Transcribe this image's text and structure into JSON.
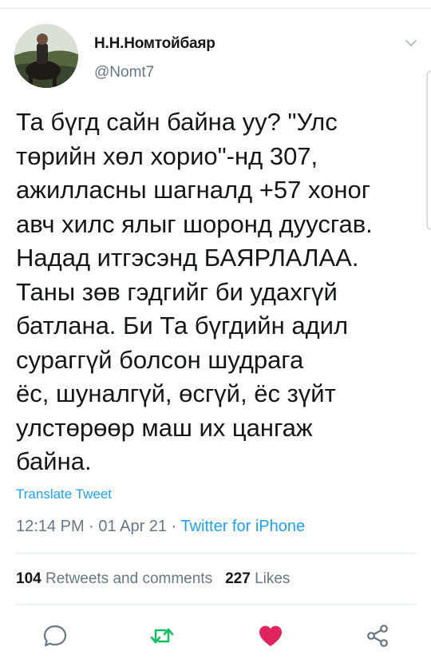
{
  "tweet": {
    "author_name": "Н.Н.Номтойбаяр",
    "author_handle": "@Nomt7",
    "text_lines": [
      "Та бүгд сайн байна уу? \"Улс",
      "төрийн хөл хорио\"-нд 307,",
      "ажилласны шагналд +57 хоног",
      "авч хилс ялыг шоронд дуусгав.",
      "Надад итгэсэнд БАЯРЛАЛАА.",
      "Таны зөв гэдгийг би удахгүй",
      "батлана. Би Та бүгдийн адил",
      "сураггүй болсон шудрага",
      "ёс, шуналгүй, өсгүй, ёс зүйт",
      "улстөрөөр маш их цангаж",
      "байна."
    ],
    "translate_label": "Translate Tweet",
    "time": "12:14 PM",
    "date": "01 Apr 21",
    "separator": "·",
    "source": "Twitter for iPhone",
    "retweets_count": "104",
    "retweets_label": "Retweets and comments",
    "likes_count": "227",
    "likes_label": "Likes"
  },
  "icons": {
    "menu": "chevron-down-icon",
    "reply": "reply-icon",
    "retweet": "retweet-icon",
    "like": "heart-icon",
    "share": "share-icon"
  },
  "colors": {
    "text": "#14171a",
    "secondary": "#657786",
    "link": "#1da1f2",
    "retweet_green": "#17bf63",
    "like_red": "#e0245e",
    "divider": "#e1e8ed"
  }
}
